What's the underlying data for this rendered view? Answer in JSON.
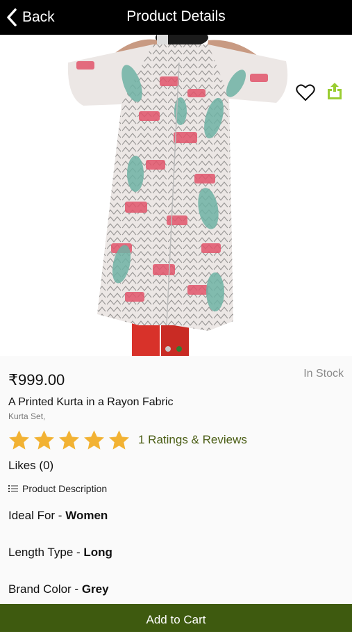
{
  "header": {
    "back_label": "Back",
    "title": "Product Details"
  },
  "colors": {
    "header_bg": "#000000",
    "accent_green": "#3e5a0f",
    "star_color": "#f2b233",
    "share_icon_color": "#9acd32",
    "in_stock_color": "#8a8a8a"
  },
  "gallery": {
    "image_icon": "product-photo",
    "slide_count": 2,
    "active_slide": 2
  },
  "product": {
    "price": "₹999.00",
    "stock_status": "In Stock",
    "name": "A Printed Kurta in a Rayon Fabric",
    "category": "Kurta Set,",
    "rating": 5,
    "rating_max": 5,
    "reviews_text": "1 Ratings & Reviews",
    "likes_text": "Likes (0)"
  },
  "description": {
    "heading": "Product Description",
    "specs": [
      {
        "label": "Ideal For - ",
        "value": "Women"
      },
      {
        "label": "Length Type - ",
        "value": "Long"
      },
      {
        "label": "Brand Color - ",
        "value": "Grey"
      }
    ]
  },
  "actions": {
    "add_to_cart": "Add to Cart"
  }
}
